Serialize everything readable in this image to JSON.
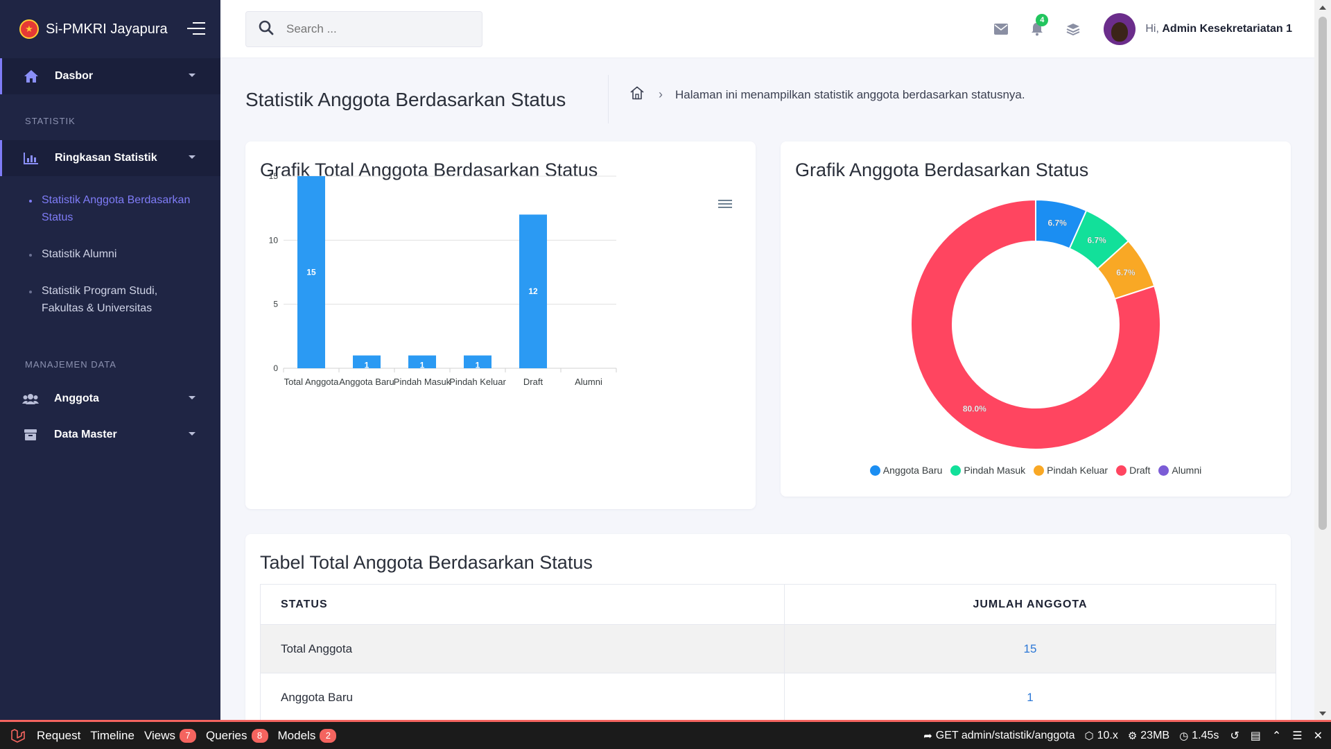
{
  "brand": {
    "name": "Si-PMKRI Jayapura",
    "logo_text": "★"
  },
  "sidebar": {
    "dashboard": {
      "label": "Dasbor",
      "icon": "home-icon"
    },
    "section_statistik": "STATISTIK",
    "ringkasan": {
      "label": "Ringkasan Statistik",
      "icon": "bar-chart-icon"
    },
    "subitems": [
      {
        "label": "Statistik Anggota Berdasarkan Status",
        "active": true
      },
      {
        "label": "Statistik Alumni",
        "active": false
      },
      {
        "label": "Statistik Program Studi, Fakultas & Universitas",
        "active": false
      }
    ],
    "section_manajemen": "MANAJEMEN DATA",
    "anggota": {
      "label": "Anggota",
      "icon": "users-icon"
    },
    "data_master": {
      "label": "Data Master",
      "icon": "archive-icon"
    }
  },
  "topbar": {
    "search_placeholder": "Search ...",
    "notification_count": "4",
    "greeting": "Hi,",
    "user_name": "Admin Kesekretariatan 1"
  },
  "page": {
    "title": "Statistik Anggota Berdasarkan Status",
    "breadcrumb_text": "Halaman ini menampilkan statistik anggota berdasarkan statusnya."
  },
  "bar_card": {
    "title": "Grafik Total Anggota Berdasarkan Status"
  },
  "donut_card": {
    "title": "Grafik Anggota Berdasarkan Status"
  },
  "table_card": {
    "title": "Tabel Total Anggota Berdasarkan Status",
    "headers": [
      "STATUS",
      "JUMLAH ANGGOTA"
    ],
    "rows": [
      {
        "status": "Total Anggota",
        "count": "15"
      },
      {
        "status": "Anggota Baru",
        "count": "1"
      }
    ]
  },
  "chart_data": [
    {
      "type": "bar",
      "title": "Grafik Total Anggota Berdasarkan Status",
      "categories": [
        "Total Anggota",
        "Anggota Baru",
        "Pindah Masuk",
        "Pindah Keluar",
        "Draft",
        "Alumni"
      ],
      "values": [
        15,
        1,
        1,
        1,
        12,
        0
      ],
      "ylim": [
        0,
        15
      ],
      "yticks": [
        0,
        5,
        10,
        15
      ],
      "grid": true,
      "color": "#2b9af3"
    },
    {
      "type": "pie",
      "title": "Grafik Anggota Berdasarkan Status",
      "labels": [
        "Anggota Baru",
        "Pindah Masuk",
        "Pindah Keluar",
        "Draft",
        "Alumni"
      ],
      "values": [
        1,
        1,
        1,
        12,
        0
      ],
      "percent_labels": [
        "6.7%",
        "6.7%",
        "6.7%",
        "80.0%",
        ""
      ],
      "colors": [
        "#1b8ef2",
        "#12e09a",
        "#f9a825",
        "#ff4560",
        "#7b5cd6"
      ],
      "donut": true,
      "legend": "bottom"
    }
  ],
  "debugbar": {
    "tabs": [
      {
        "label": "Request",
        "badge": ""
      },
      {
        "label": "Timeline",
        "badge": ""
      },
      {
        "label": "Views",
        "badge": "7"
      },
      {
        "label": "Queries",
        "badge": "8"
      },
      {
        "label": "Models",
        "badge": "2"
      }
    ],
    "route": "GET admin/statistik/anggota",
    "version": "10.x",
    "memory": "23MB",
    "time": "1.45s"
  }
}
